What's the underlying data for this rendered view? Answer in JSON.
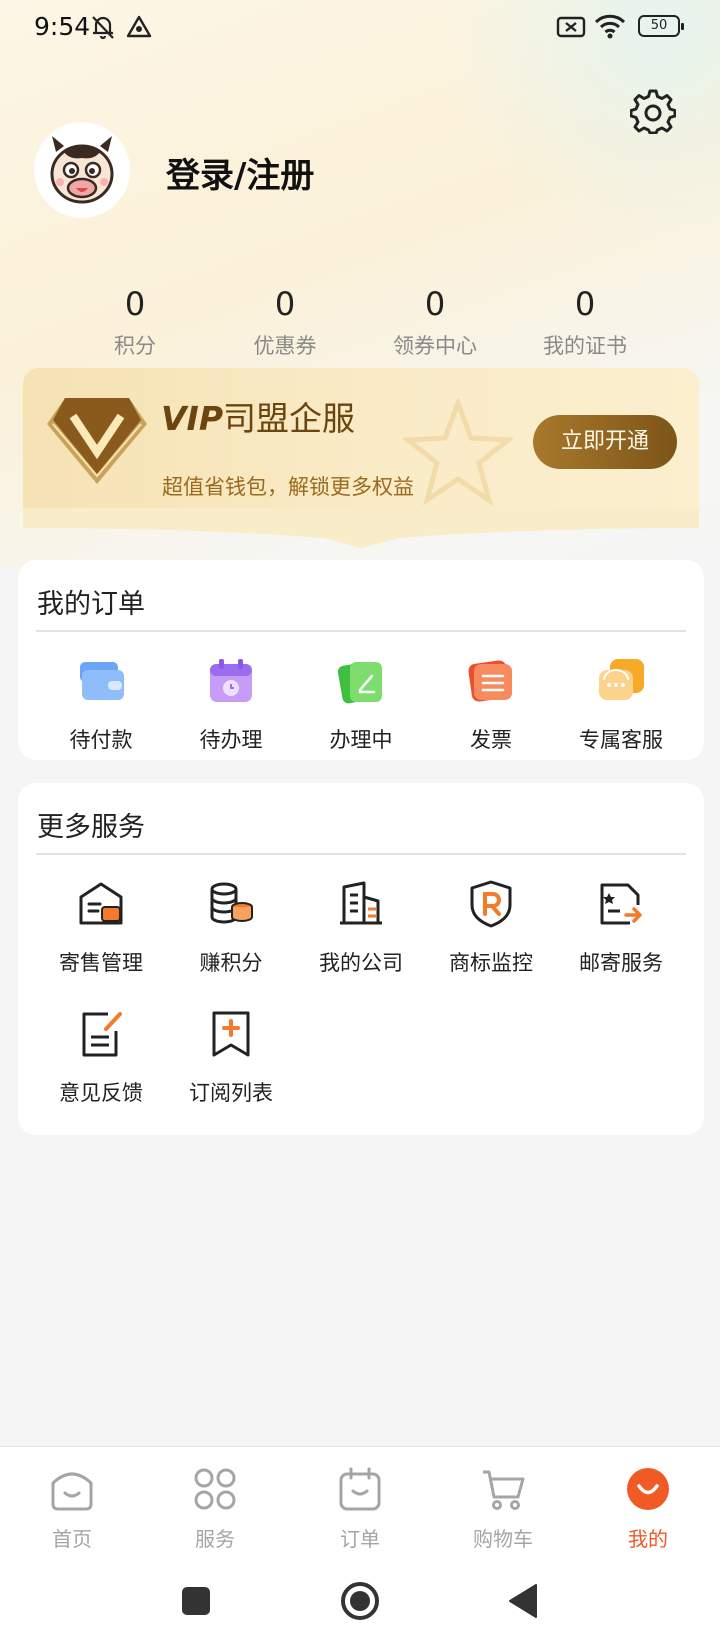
{
  "status_bar": {
    "time": "9:54",
    "battery": "50"
  },
  "profile": {
    "login_label": "登录/注册"
  },
  "stats": [
    {
      "value": "0",
      "label": "积分"
    },
    {
      "value": "0",
      "label": "优惠券"
    },
    {
      "value": "0",
      "label": "领券中心"
    },
    {
      "value": "0",
      "label": "我的证书"
    }
  ],
  "vip": {
    "brand_prefix": "VIP",
    "brand_name": "司盟企服",
    "subtitle": "超值省钱包，解锁更多权益",
    "button": "立即开通"
  },
  "orders": {
    "title": "我的订单",
    "items": [
      {
        "label": "待付款",
        "icon": "wallet-icon"
      },
      {
        "label": "待办理",
        "icon": "calendar-icon"
      },
      {
        "label": "办理中",
        "icon": "edit-note-icon"
      },
      {
        "label": "发票",
        "icon": "invoice-icon"
      },
      {
        "label": "专属客服",
        "icon": "chat-bubble-icon"
      }
    ]
  },
  "services": {
    "title": "更多服务",
    "items": [
      {
        "label": "寄售管理",
        "icon": "store-icon"
      },
      {
        "label": "赚积分",
        "icon": "coins-icon"
      },
      {
        "label": "我的公司",
        "icon": "building-icon"
      },
      {
        "label": "商标监控",
        "icon": "trademark-shield-icon"
      },
      {
        "label": "邮寄服务",
        "icon": "mail-doc-icon"
      },
      {
        "label": "意见反馈",
        "icon": "feedback-icon"
      },
      {
        "label": "订阅列表",
        "icon": "bookmark-add-icon"
      }
    ]
  },
  "bottom_nav": [
    {
      "label": "首页",
      "icon": "home-icon",
      "active": false
    },
    {
      "label": "服务",
      "icon": "grid-icon",
      "active": false
    },
    {
      "label": "订单",
      "icon": "orders-icon",
      "active": false
    },
    {
      "label": "购物车",
      "icon": "cart-icon",
      "active": false
    },
    {
      "label": "我的",
      "icon": "profile-smile-icon",
      "active": true
    }
  ],
  "colors": {
    "accent": "#f15a24",
    "vip_gold": "#8a5d1f",
    "text_muted": "#8a8a8a"
  }
}
